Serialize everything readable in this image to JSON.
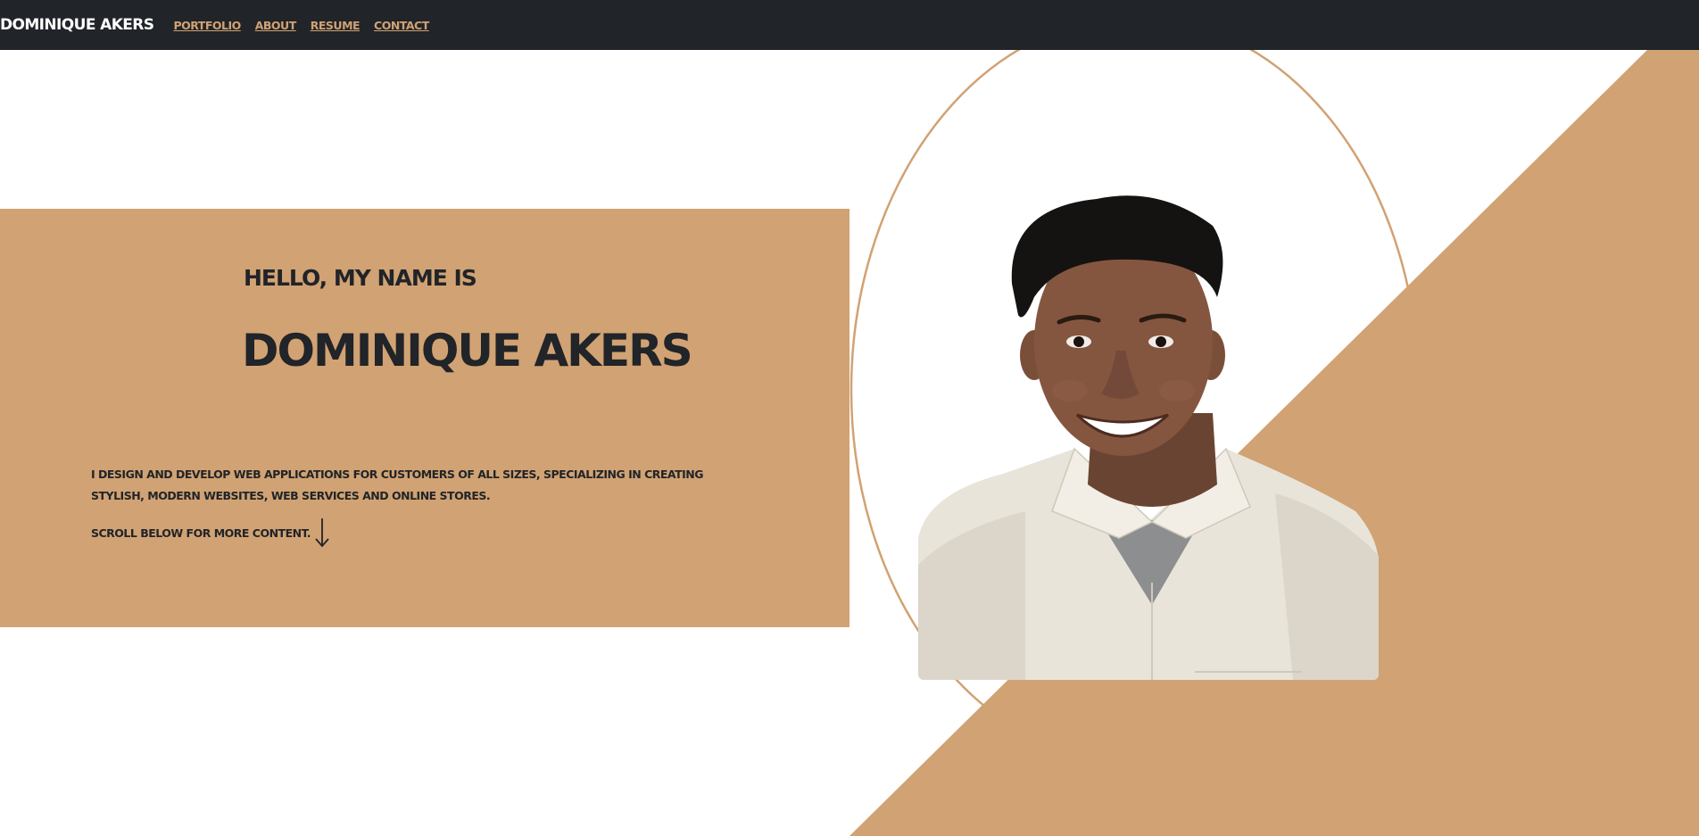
{
  "nav": {
    "brand": "DOMINIQUE AKERS",
    "links": [
      "PORTFOLIO",
      "ABOUT",
      "RESUME",
      "CONTACT"
    ]
  },
  "hero": {
    "greeting": "HELLO, MY NAME IS",
    "name": "DOMINIQUE AKERS",
    "intro": "I DESIGN AND DEVELOP WEB APPLICATIONS FOR CUSTOMERS OF ALL SIZES, SPECIALIZING IN CREATING STYLISH, MODERN WEBSITES, WEB SERVICES AND ONLINE STORES.",
    "scroll_hint": "SCROLL BELOW FOR MORE CONTENT.",
    "scroll_icon": "arrow-down-icon"
  },
  "portrait": {
    "icon": "person-portrait-photo"
  },
  "colors": {
    "nav_background": "#212428",
    "accent": "#d1a273",
    "text_dark": "#212428",
    "background": "#ffffff"
  }
}
